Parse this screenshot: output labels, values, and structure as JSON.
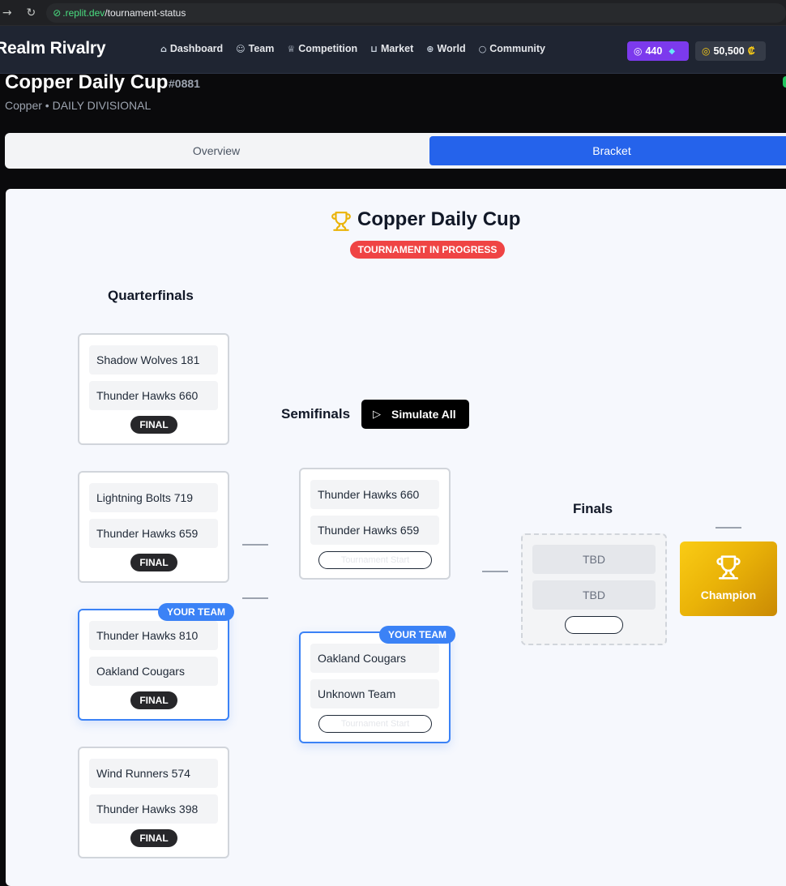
{
  "browser": {
    "url_host": ".replit.dev",
    "url_path": "/tournament-status"
  },
  "header": {
    "brand": "Realm Rivalry",
    "nav": [
      {
        "label": "Dashboard",
        "icon": "home-icon"
      },
      {
        "label": "Team",
        "icon": "users-icon"
      },
      {
        "label": "Competition",
        "icon": "trophy-icon"
      },
      {
        "label": "Market",
        "icon": "cart-icon"
      },
      {
        "label": "World",
        "icon": "globe-icon"
      },
      {
        "label": "Community",
        "icon": "chat-icon"
      }
    ],
    "gems": "440",
    "coins": "50,500",
    "coin_symbol": "₡"
  },
  "page": {
    "title": "Copper Daily Cup",
    "id": "#0881",
    "subtitle": "Copper • DAILY DIVISIONAL"
  },
  "tabs": {
    "overview": "Overview",
    "bracket": "Bracket"
  },
  "bracket": {
    "title": "Copper Daily Cup",
    "status": "TOURNAMENT IN PROGRESS",
    "your_team_label": "YOUR TEAM",
    "final_label": "FINAL",
    "pending_label": "Tournament Start",
    "simulate_label": "Simulate All",
    "champion_label": "Champion",
    "rounds": {
      "quarterfinals": "Quarterfinals",
      "semifinals": "Semifinals",
      "finals": "Finals"
    },
    "quarterfinals": [
      {
        "team1": "Shadow Wolves 181",
        "team2": "Thunder Hawks 660"
      },
      {
        "team1": "Lightning Bolts 719",
        "team2": "Thunder Hawks 659"
      },
      {
        "team1": "Thunder Hawks 810",
        "team2": "Oakland Cougars"
      },
      {
        "team1": "Wind Runners 574",
        "team2": "Thunder Hawks 398"
      }
    ],
    "semifinals": [
      {
        "team1": "Thunder Hawks 660",
        "team2": "Thunder Hawks 659"
      },
      {
        "team1": "Oakland Cougars",
        "team2": "Unknown Team"
      }
    ],
    "finals": {
      "team1": "TBD",
      "team2": "TBD"
    }
  },
  "colors": {
    "accent_blue": "#2563eb",
    "status_red": "#ef4444",
    "gems_purple": "#7c3aed",
    "champion_gold": "#eab308"
  }
}
